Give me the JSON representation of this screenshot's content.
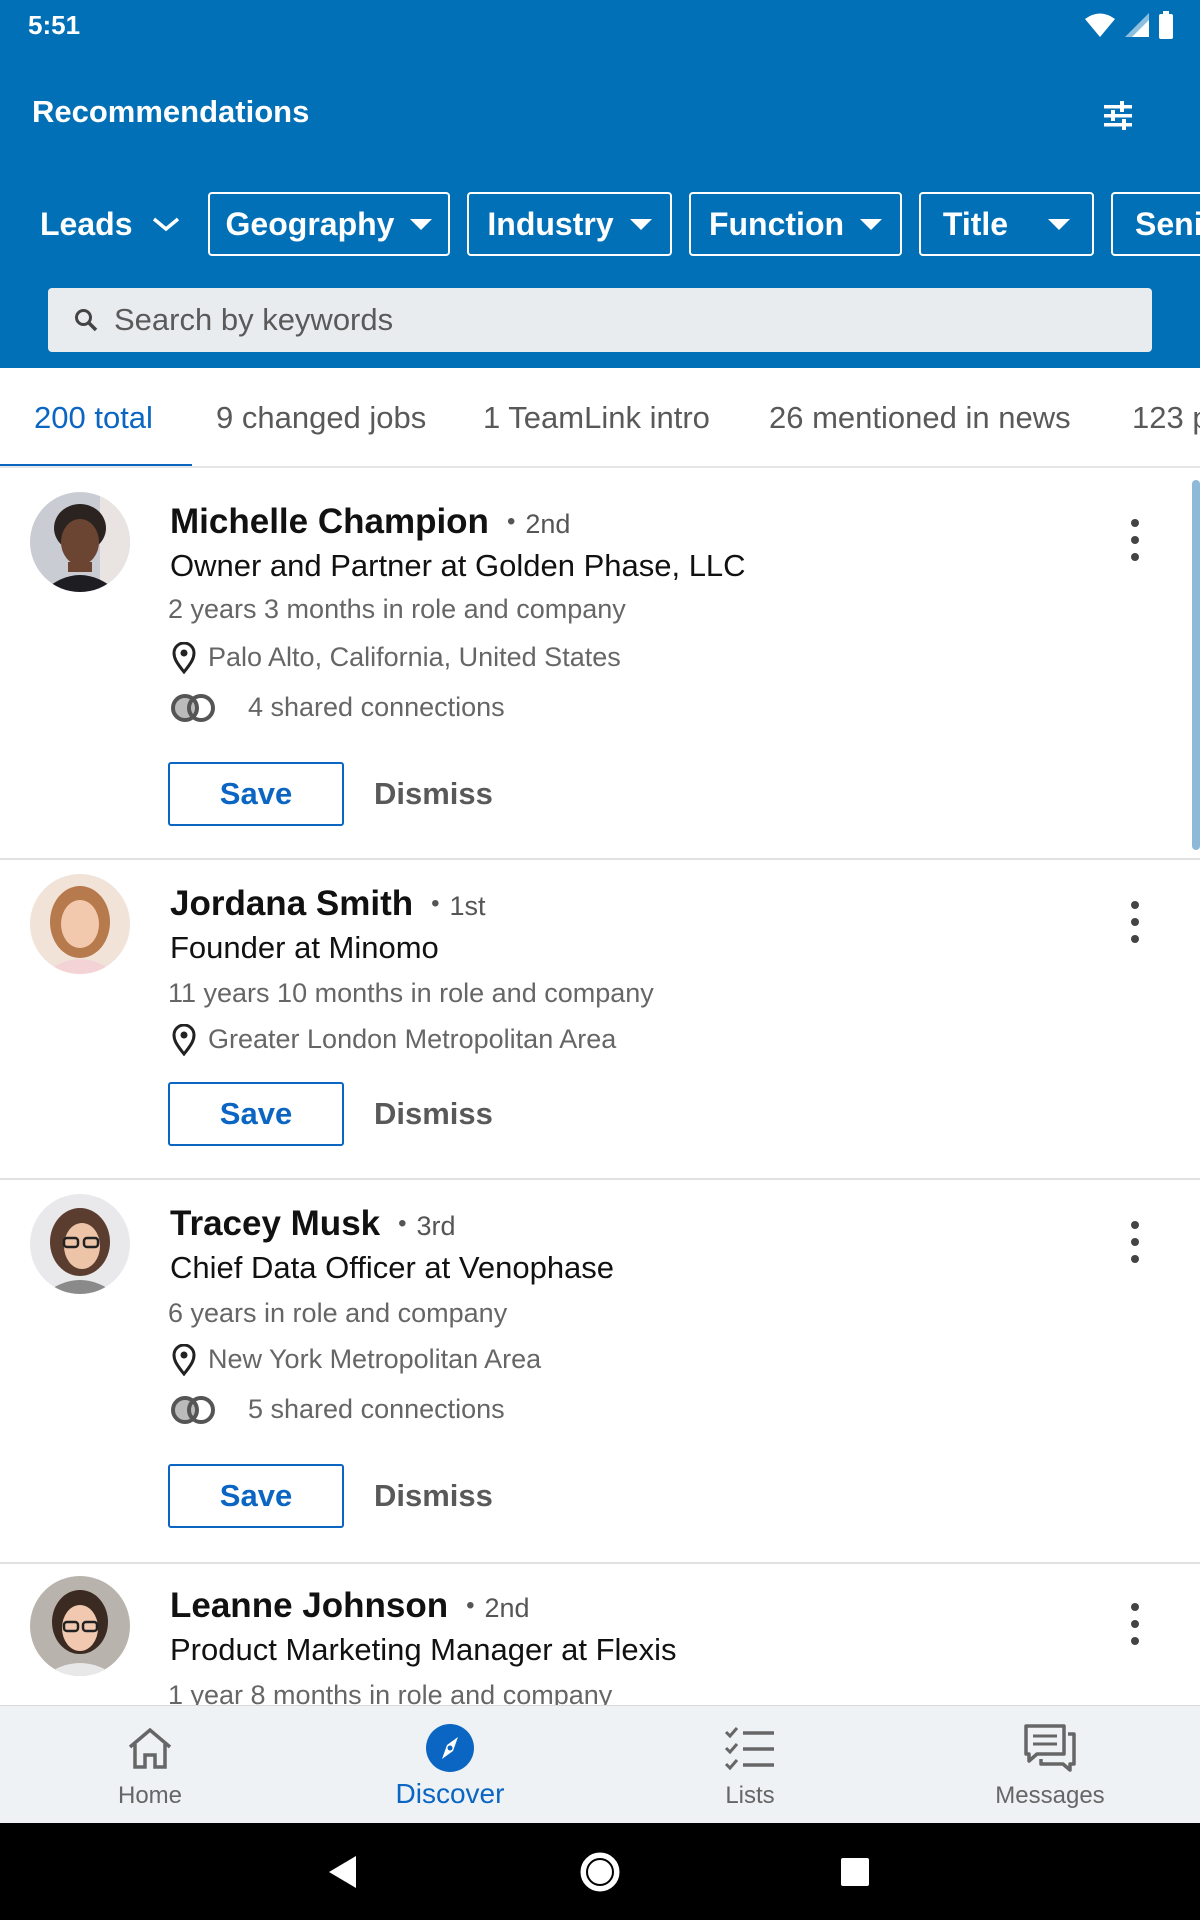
{
  "status_bar": {
    "time": "5:51"
  },
  "header": {
    "title": "Recommendations",
    "type_select": "Leads",
    "filters": [
      "Geography",
      "Industry",
      "Function",
      "Title",
      "Seni"
    ],
    "search": {
      "placeholder": "Search by keywords",
      "value": ""
    }
  },
  "tabs": [
    {
      "label": "200 total",
      "active": true
    },
    {
      "label": "9 changed jobs",
      "active": false
    },
    {
      "label": "1 TeamLink intro",
      "active": false
    },
    {
      "label": "26 mentioned in news",
      "active": false
    },
    {
      "label": "123 p",
      "active": false
    }
  ],
  "leads": [
    {
      "name": "Michelle Champion",
      "degree": "2nd",
      "headline": "Owner and Partner at Golden Phase, LLC",
      "tenure": "2 years 3 months in role and company",
      "location": "Palo Alto, California, United States",
      "shared": "4 shared connections",
      "save_label": "Save",
      "dismiss_label": "Dismiss"
    },
    {
      "name": "Jordana Smith",
      "degree": "1st",
      "headline": "Founder at Minomo",
      "tenure": "11 years 10 months in role and company",
      "location": "Greater London Metropolitan Area",
      "save_label": "Save",
      "dismiss_label": "Dismiss"
    },
    {
      "name": "Tracey Musk",
      "degree": "3rd",
      "headline": "Chief Data Officer at Venophase",
      "tenure": "6 years in role and company",
      "location": "New York Metropolitan Area",
      "shared": "5 shared connections",
      "save_label": "Save",
      "dismiss_label": "Dismiss"
    },
    {
      "name": "Leanne Johnson",
      "degree": "2nd",
      "headline": "Product Marketing Manager at Flexis",
      "tenure": "1 year 8 months in role and company"
    }
  ],
  "bottom_nav": [
    {
      "label": "Home",
      "icon": "home-icon",
      "active": false
    },
    {
      "label": "Discover",
      "icon": "compass-icon",
      "active": true
    },
    {
      "label": "Lists",
      "icon": "checklist-icon",
      "active": false
    },
    {
      "label": "Messages",
      "icon": "messages-icon",
      "active": false
    }
  ],
  "colors": {
    "brand": "#0270b7",
    "accent": "#0a66c2"
  }
}
